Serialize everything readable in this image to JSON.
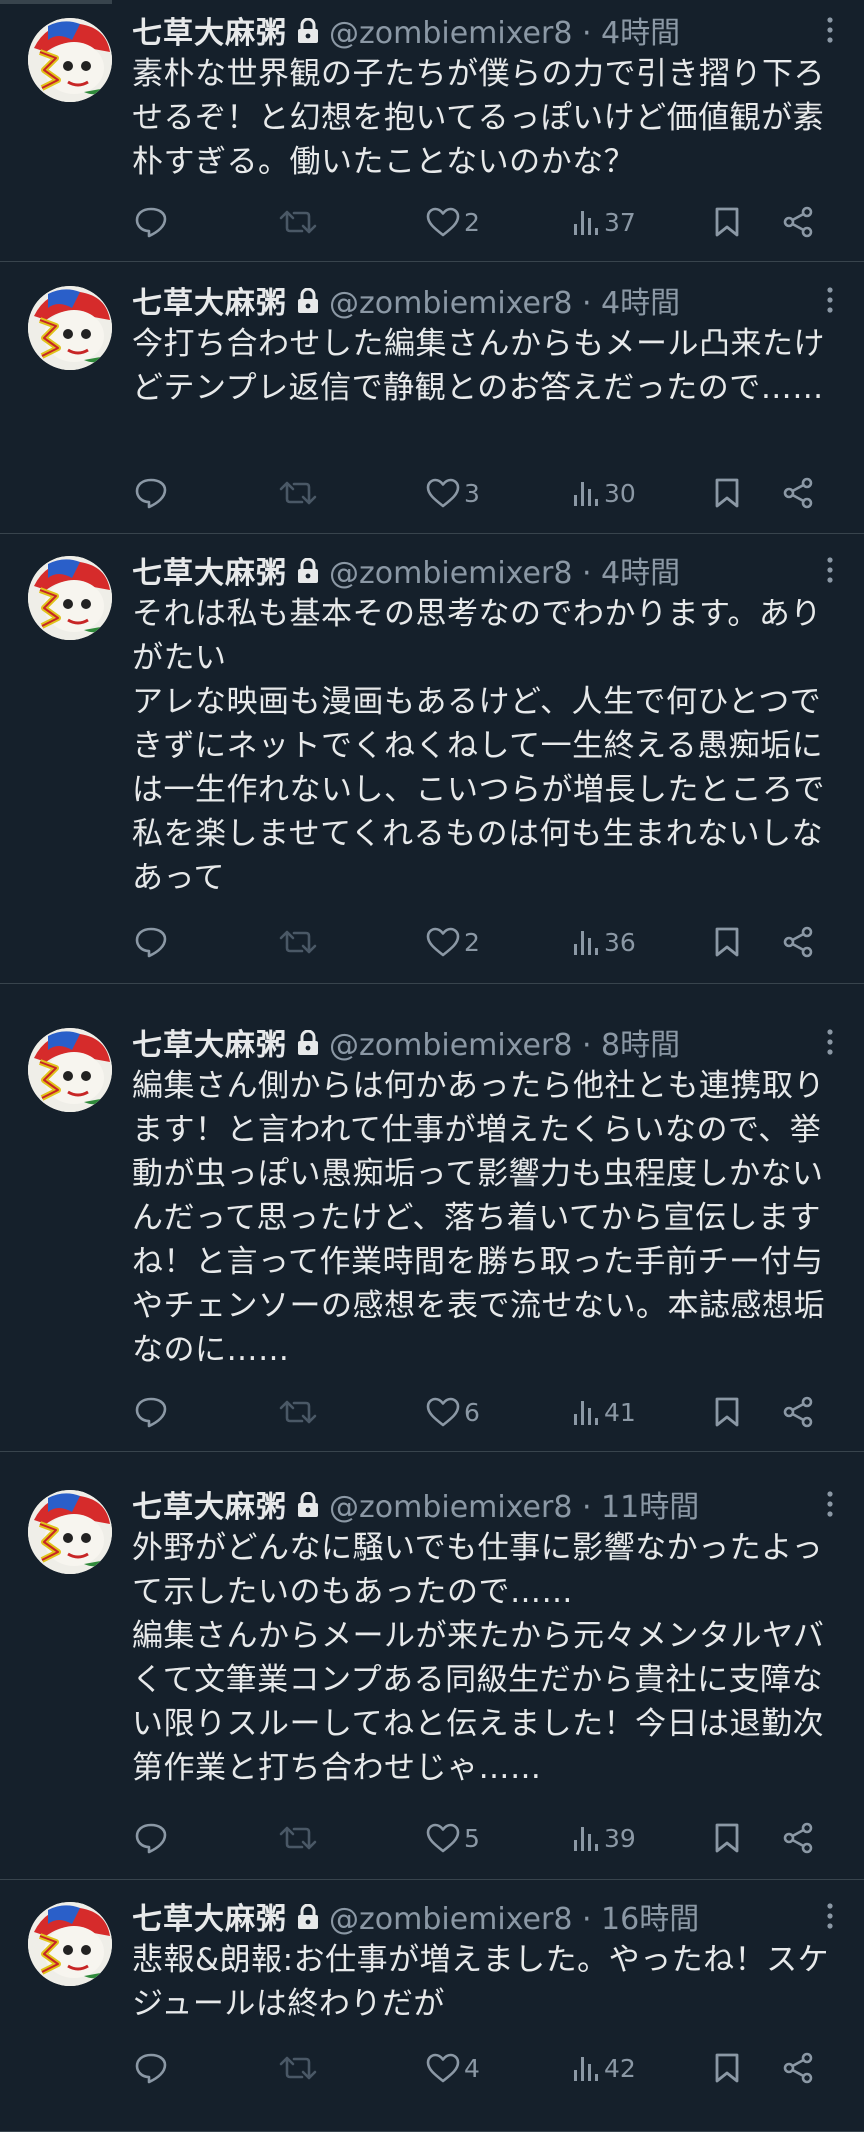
{
  "tweets": [
    {
      "name": "七草大麻粥",
      "handle": "@zombiemixer8 · 4時間",
      "text": "素朴な世界観の子たちが僕らの力で引き摺り下ろせるぞ！と幻想を抱いてるっぽいけど価値観が素朴すぎる。働いたことないのかな？",
      "likes": "2",
      "views": "37"
    },
    {
      "name": "七草大麻粥",
      "handle": "@zombiemixer8 · 4時間",
      "text": "今打ち合わせした編集さんからもメール凸来たけどテンプレ返信で静観とのお答えだったので……",
      "likes": "3",
      "views": "30"
    },
    {
      "name": "七草大麻粥",
      "handle": "@zombiemixer8 · 4時間",
      "text": "それは私も基本その思考なのでわかります。ありがたい\nアレな映画も漫画もあるけど、人生で何ひとつできずにネットでくねくねして一生終える愚痴垢には一生作れないし、こいつらが増長したところで私を楽しませてくれるものは何も生まれないしなあって",
      "likes": "2",
      "views": "36"
    },
    {
      "name": "七草大麻粥",
      "handle": "@zombiemixer8 · 8時間",
      "text": "編集さん側からは何かあったら他社とも連携取ります！と言われて仕事が増えたくらいなので、挙動が虫っぽい愚痴垢って影響力も虫程度しかないんだって思ったけど、落ち着いてから宣伝しますね！と言って作業時間を勝ち取った手前チー付与やチェンソーの感想を表で流せない。本誌感想垢なのに……",
      "likes": "6",
      "views": "41"
    },
    {
      "name": "七草大麻粥",
      "handle": "@zombiemixer8 · 11時間",
      "text": "外野がどんなに騒いでも仕事に影響なかったよって示したいのもあったので……\n編集さんからメールが来たから元々メンタルヤバくて文筆業コンプある同級生だから貴社に支障ない限りスルーしてねと伝えました！今日は退勤次第作業と打ち合わせじゃ……",
      "likes": "5",
      "views": "39"
    },
    {
      "name": "七草大麻粥",
      "handle": "@zombiemixer8 · 16時間",
      "text": "悲報&朗報:お仕事が増えました。やったね！スケジュールは終わりだが",
      "likes": "4",
      "views": "42"
    }
  ],
  "icons": {
    "reply": "reply-icon",
    "retweet": "retweet-icon",
    "like": "heart-icon",
    "views": "views-icon",
    "bookmark": "bookmark-icon",
    "share": "share-icon",
    "lock": "lock-icon",
    "more": "more-icon"
  },
  "colors": {
    "background": "#15202b",
    "text": "#e7e9ea",
    "secondary": "#8b98a5",
    "divider": "#38444d"
  }
}
